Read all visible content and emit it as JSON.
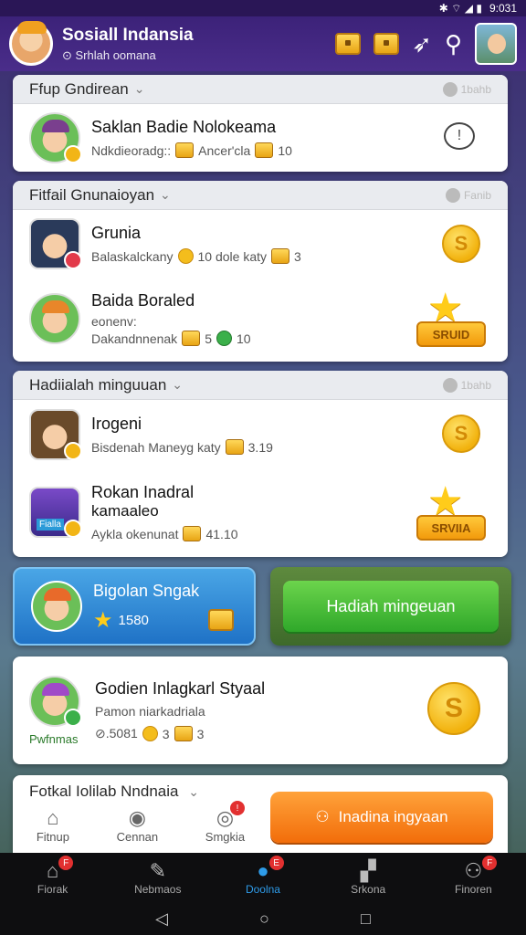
{
  "status": {
    "time": "9:031",
    "icons": "✱ ⌔ ◢ ▮"
  },
  "header": {
    "title": "Sosiall Indansia",
    "subtitle": "⊙ Srhlah oomana"
  },
  "sections": [
    {
      "title": "Ffup Gndirean",
      "pill": "1bahb",
      "rows": [
        {
          "name": "Saklan Badie Nolokeama",
          "meta1": "Ndkdieoradg::",
          "meta2": "Ancer'cla",
          "meta3": "10"
        }
      ]
    },
    {
      "title": "Fitfail Gnunaioyan",
      "pill": "Fanib",
      "rows": [
        {
          "name": "Grunia",
          "meta1": "Balaskalckany",
          "meta2": "10 dole katy",
          "meta3": "3"
        },
        {
          "name": "Baida Boraled",
          "sub": "eonenv:",
          "meta1": "Dakandnnenak",
          "meta2": "5",
          "meta3": "10",
          "badge": "SRUID"
        }
      ]
    },
    {
      "title": "Hadiialah minguuan",
      "pill": "1bahb",
      "rows": [
        {
          "name": "Irogeni",
          "meta1": "Bisdenah Maneyg katy",
          "meta2": "3.19"
        },
        {
          "name": "Rokan Inadral",
          "sub": "kamaaleo",
          "meta1": "Aykla okenunat",
          "meta2": "41.10",
          "badge": "SRVIIA",
          "thumb": "Fialla"
        }
      ]
    }
  ],
  "tile_blue": {
    "title": "Bigolan Sngak",
    "value": "1580"
  },
  "tile_green": {
    "button": "Hadiah mingeuan"
  },
  "featured": {
    "name": "Godien Inlagkarl Styaal",
    "sub": "Pamon niarkadriala",
    "tag": "Pwfnmas",
    "val1": "⊘.5081",
    "val2": "3",
    "val3": "3"
  },
  "bottom_section": {
    "title": "Fotkal Iolilab Nndnaia",
    "tabs": [
      {
        "label": "Fitnup",
        "icon": "home-icon"
      },
      {
        "label": "Cennan",
        "icon": "gamepad-icon"
      },
      {
        "label": "Smgkia",
        "icon": "target-icon",
        "badge": "!"
      }
    ],
    "button": "Inadina ingyaan"
  },
  "nav": [
    {
      "label": "Fiorak",
      "badge": "F"
    },
    {
      "label": "Nebmaos"
    },
    {
      "label": "Doolna",
      "badge": "E",
      "active": true
    },
    {
      "label": "Srkona"
    },
    {
      "label": "Finoren",
      "badge": "F"
    }
  ]
}
